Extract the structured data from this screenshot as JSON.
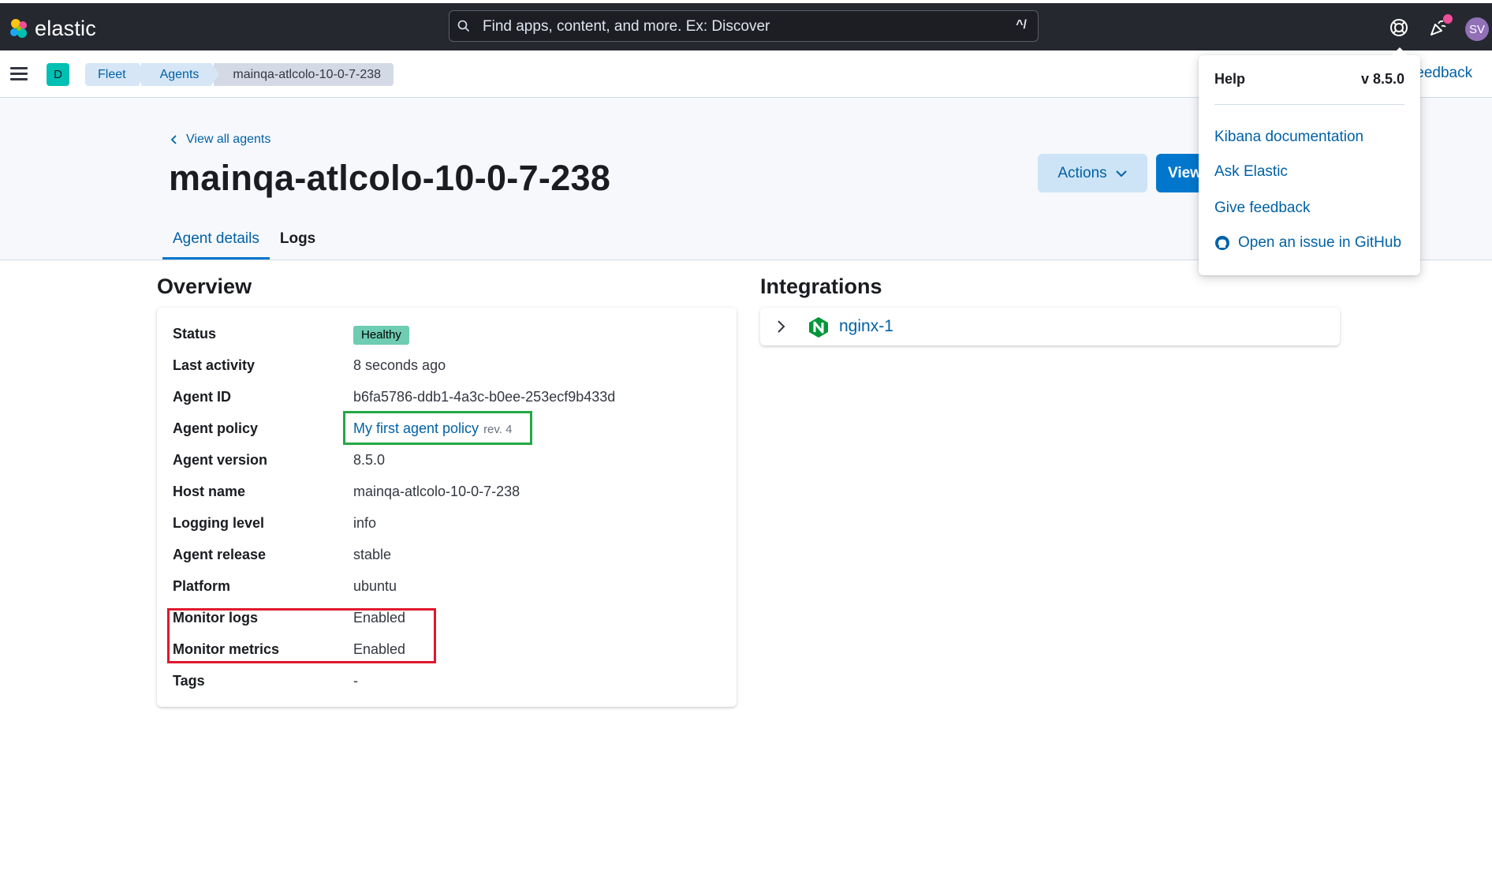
{
  "topbar": {
    "brand": "elastic",
    "search_placeholder": "Find apps, content, and more. Ex: Discover",
    "search_shortcut": "^/",
    "avatar_initials": "SV"
  },
  "subbar": {
    "space_initial": "D",
    "breadcrumbs": [
      "Fleet",
      "Agents",
      "mainqa-atlcolo-10-0-7-238"
    ],
    "feedback_label": "feedback"
  },
  "header": {
    "back_link": "View all agents",
    "title": "mainqa-atlcolo-10-0-7-238",
    "actions_label": "Actions",
    "view_label": "View",
    "tabs": [
      {
        "label": "Agent details",
        "active": true
      },
      {
        "label": "Logs",
        "active": false
      }
    ]
  },
  "overview": {
    "title": "Overview",
    "status": {
      "label": "Status",
      "value": "Healthy",
      "color": "#6dccb1"
    },
    "last_activity": {
      "label": "Last activity",
      "value": "8 seconds ago"
    },
    "agent_id": {
      "label": "Agent ID",
      "value": "b6fa5786-ddb1-4a3c-b0ee-253ecf9b433d"
    },
    "agent_policy": {
      "label": "Agent policy",
      "value": "My first agent policy",
      "revision": "rev. 4"
    },
    "agent_version": {
      "label": "Agent version",
      "value": "8.5.0"
    },
    "host_name": {
      "label": "Host name",
      "value": "mainqa-atlcolo-10-0-7-238"
    },
    "logging_level": {
      "label": "Logging level",
      "value": "info"
    },
    "agent_release": {
      "label": "Agent release",
      "value": "stable"
    },
    "platform": {
      "label": "Platform",
      "value": "ubuntu"
    },
    "monitor_logs": {
      "label": "Monitor logs",
      "value": "Enabled"
    },
    "monitor_metrics": {
      "label": "Monitor metrics",
      "value": "Enabled"
    },
    "tags": {
      "label": "Tags",
      "value": "-"
    }
  },
  "integrations": {
    "title": "Integrations",
    "items": [
      {
        "name": "nginx-1",
        "icon": "nginx-icon"
      }
    ]
  },
  "help_menu": {
    "title": "Help",
    "version": "v 8.5.0",
    "links": [
      "Kibana documentation",
      "Ask Elastic",
      "Give feedback",
      "Open an issue in GitHub"
    ]
  },
  "annotations": {
    "green_box_color": "#22a843",
    "red_box_color": "#e0182d"
  },
  "colors": {
    "link": "#0061a6",
    "primary_button": "#0077cc",
    "topbar": "#25282f"
  }
}
